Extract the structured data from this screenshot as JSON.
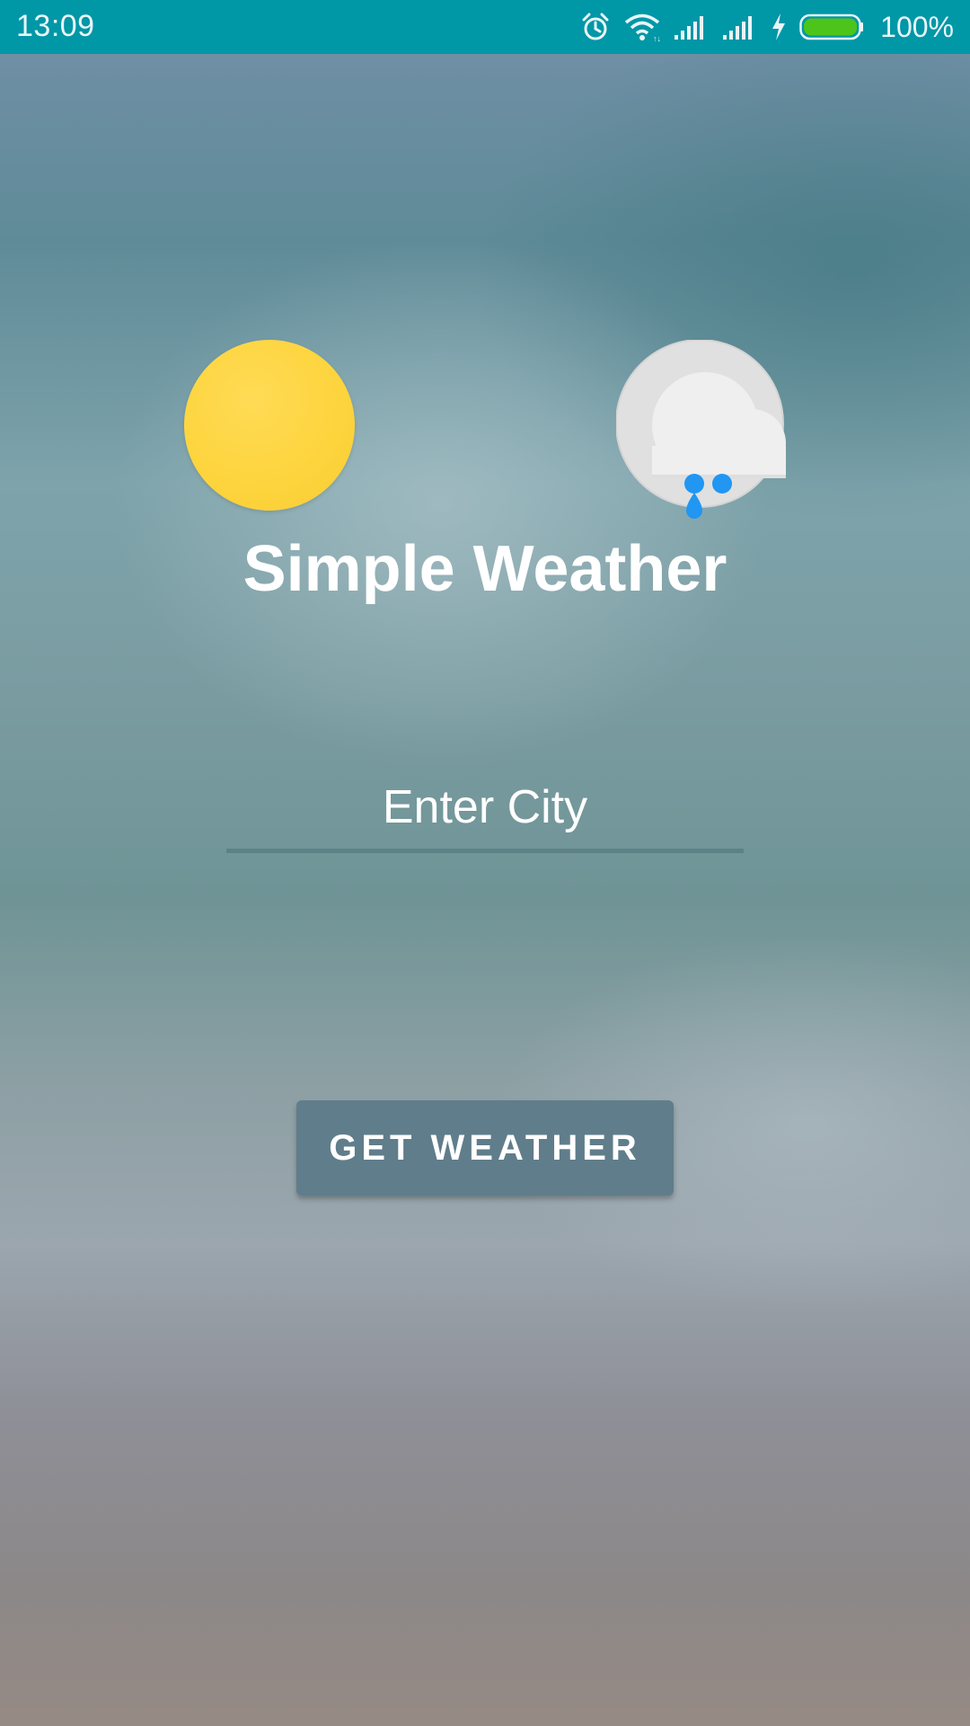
{
  "status_bar": {
    "time": "13:09",
    "battery": "100%",
    "battery_color": "#4cc41a",
    "background": "#0097a7",
    "icons": [
      "alarm-icon",
      "wifi-icon",
      "signal-icon",
      "signal-icon",
      "charging-icon",
      "battery-icon"
    ]
  },
  "main": {
    "title": "Simple Weather",
    "city_input": {
      "placeholder": "Enter City",
      "value": ""
    },
    "get_weather_label": "GET WEATHER",
    "icons": [
      "sun-icon",
      "cloud-rain-icon"
    ]
  },
  "colors": {
    "button": "#607d8b",
    "sun": "#fdd43c",
    "raindrop": "#2196f3"
  }
}
